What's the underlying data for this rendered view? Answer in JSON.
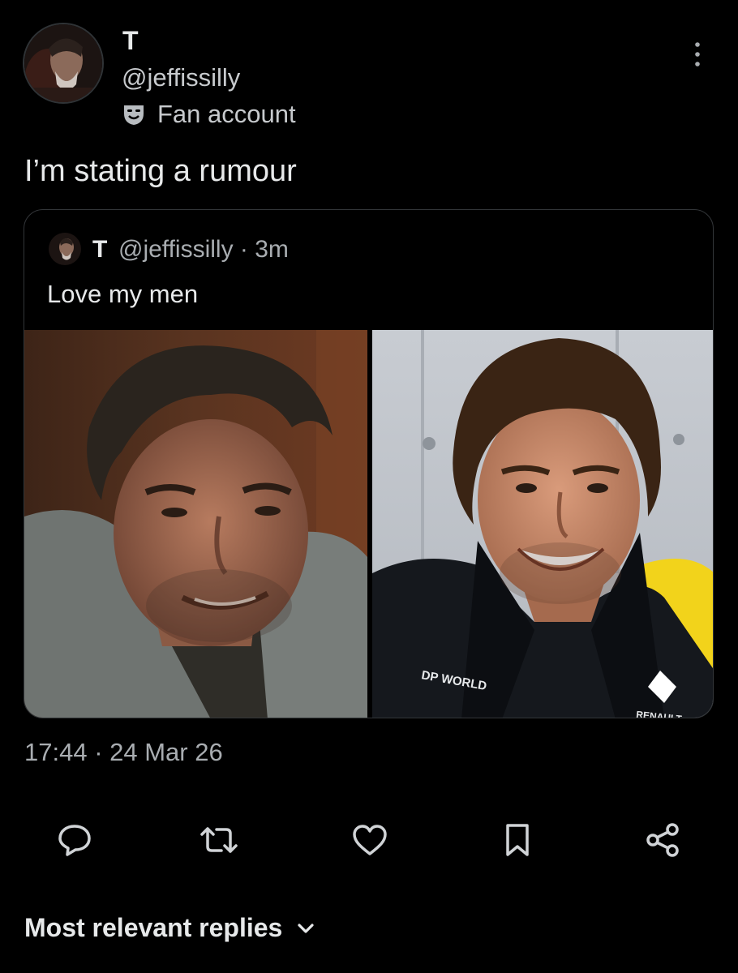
{
  "tweet": {
    "author": {
      "display_name": "T",
      "handle": "@jeffissilly",
      "label": "Fan account",
      "label_icon": "theater-masks-icon"
    },
    "text": "I’m stating a rumour",
    "timestamp": "17:44 · 24 Mar 26"
  },
  "quoted_tweet": {
    "display_name": "T",
    "handle_time": "@jeffissilly · 3m",
    "text": "Love my men",
    "images": [
      {
        "subject": "man-in-grey-shirt-smiling-photo"
      },
      {
        "subject": "smiling-man-in-renault-team-jacket-photo",
        "jacket_text": [
          "DP WORLD",
          "RENAULT"
        ]
      }
    ]
  },
  "actions": [
    {
      "name": "reply",
      "icon": "reply-icon"
    },
    {
      "name": "retweet",
      "icon": "retweet-icon"
    },
    {
      "name": "like",
      "icon": "heart-icon"
    },
    {
      "name": "bookmark",
      "icon": "bookmark-icon"
    },
    {
      "name": "share",
      "icon": "share-icon"
    }
  ],
  "replies": {
    "sort_label": "Most relevant replies"
  },
  "colors": {
    "background": "#000000",
    "text_primary": "#e7e9ea",
    "text_secondary": "#a9adb1",
    "border": "#333639",
    "icon": "#d0d3d6"
  }
}
